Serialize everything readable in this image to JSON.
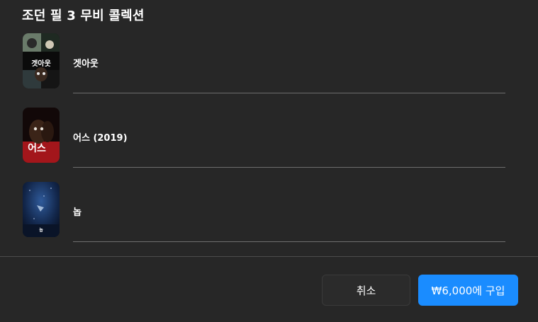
{
  "dialog": {
    "title": "조던 필 3 무비 콜렉션"
  },
  "movies": [
    {
      "title": "겟아웃",
      "poster_icon": "get-out-poster",
      "poster_text": "겟아웃"
    },
    {
      "title": "어스 (2019)",
      "poster_icon": "us-poster",
      "poster_text": "어스"
    },
    {
      "title": "놉",
      "poster_icon": "nope-poster",
      "poster_text": "놉"
    }
  ],
  "buttons": {
    "cancel_label": "취소",
    "buy_label": "₩6,000에 구입"
  },
  "colors": {
    "background": "#272727",
    "accent": "#1a8cff",
    "divider": "#6e6e6e"
  }
}
